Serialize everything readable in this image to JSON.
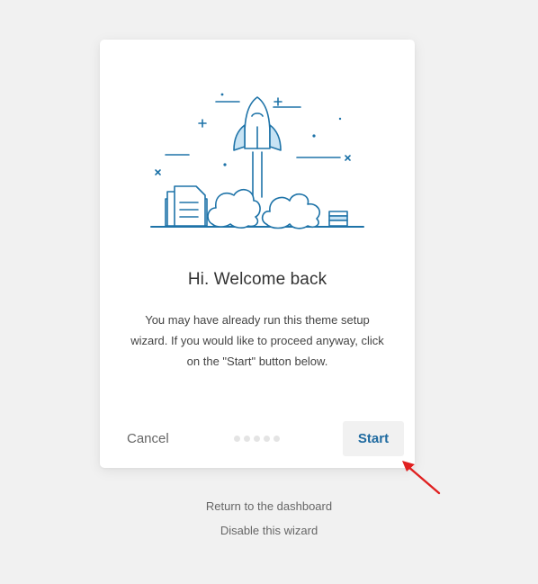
{
  "card": {
    "title": "Hi. Welcome back",
    "description": "You may have already run this theme setup wizard. If you would like to proceed anyway, click on the \"Start\" button below.",
    "cancel_label": "Cancel",
    "start_label": "Start",
    "step_count": 5
  },
  "footer": {
    "return_link": "Return to the dashboard",
    "disable_link": "Disable this wizard"
  },
  "illustration": {
    "icon": "rocket-launch-icon",
    "colors": {
      "stroke": "#1e73a8",
      "fill": "#ffffff",
      "accent_fill": "#c7e3f4"
    }
  },
  "annotation": {
    "icon": "red-arrow-icon",
    "color": "#e02020"
  }
}
